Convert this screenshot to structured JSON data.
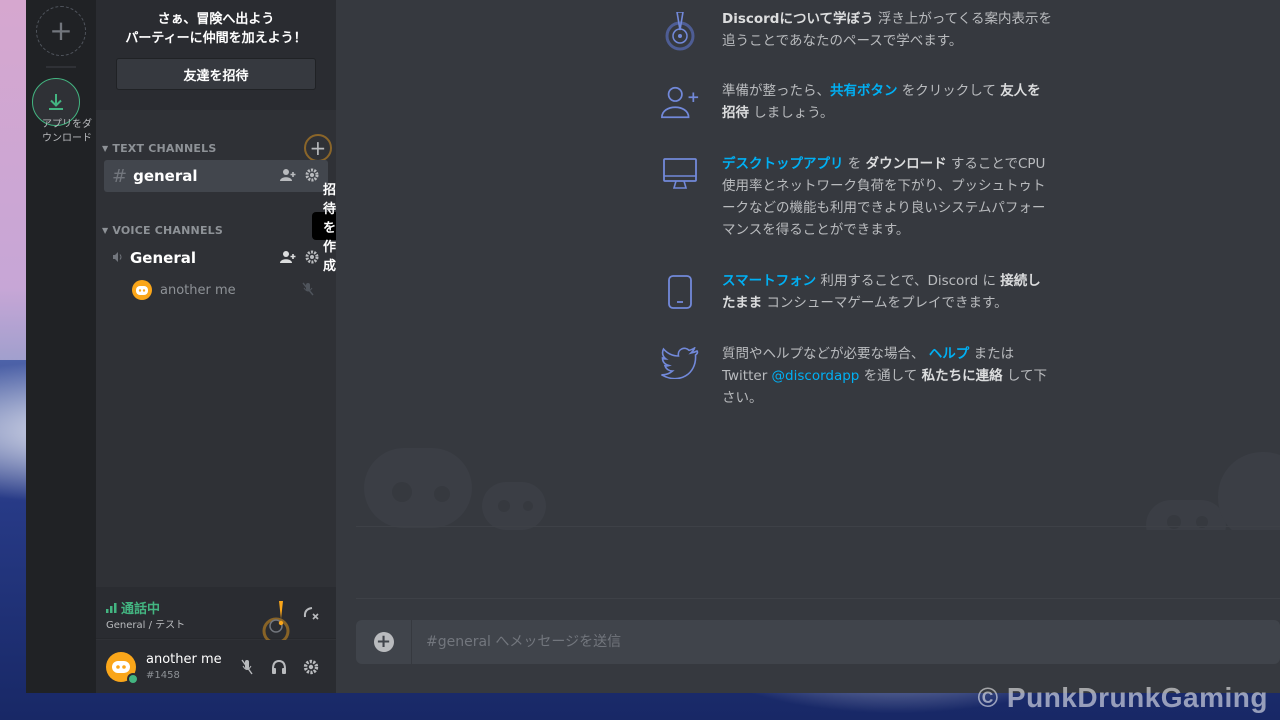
{
  "guild_rail": {
    "add_server": "+",
    "download_label": "アプリをダウンロード"
  },
  "sidebar": {
    "invite": {
      "title_line1": "さぁ、冒険へ出よう",
      "title_line2": "パーティーに仲間を加えよう！",
      "button": "友達を招待"
    },
    "text_category": "TEXT CHANNELS",
    "voice_category": "VOICE CHANNELS",
    "text_channels": [
      {
        "name": "general"
      }
    ],
    "voice_channels": [
      {
        "name": "General"
      }
    ],
    "voice_users": [
      {
        "name": "another me"
      }
    ],
    "tooltip": "招待を作成"
  },
  "voice_panel": {
    "status": "通話中",
    "channel": "General / テスト"
  },
  "user_panel": {
    "username": "another me",
    "tag": "#1458"
  },
  "welcome": {
    "items": [
      {
        "icon": "quest-icon",
        "parts": [
          [
            "b",
            "Discordについて学ぼう"
          ],
          [
            "t",
            " 浮き上がってくる案内表示を追うことであなたのペースで学べます。"
          ]
        ]
      },
      {
        "icon": "add-friend-icon",
        "parts": [
          [
            "t",
            "準備が整ったら、"
          ],
          [
            "l",
            "共有ボタン"
          ],
          [
            "t",
            " をクリックして "
          ],
          [
            "b",
            "友人を招待"
          ],
          [
            "t",
            " しましょう。"
          ]
        ]
      },
      {
        "icon": "desktop-icon",
        "parts": [
          [
            "l",
            "デスクトップアプリ"
          ],
          [
            "t",
            " を "
          ],
          [
            "b",
            "ダウンロード"
          ],
          [
            "t",
            " することでCPU使用率とネットワーク負荷を下がり、プッシュトゥトークなどの機能も利用できより良いシステムパフォーマンスを得ることができます。"
          ]
        ]
      },
      {
        "icon": "smartphone-icon",
        "parts": [
          [
            "l",
            "スマートフォン"
          ],
          [
            "t",
            " 利用することで、Discord に "
          ],
          [
            "b",
            "接続したまま"
          ],
          [
            "t",
            " コンシューマゲームをプレイできます。"
          ]
        ]
      },
      {
        "icon": "twitter-icon",
        "parts": [
          [
            "t",
            "質問やヘルプなどが必要な場合、 "
          ],
          [
            "l",
            "ヘルプ"
          ],
          [
            "t",
            " または Twitter "
          ],
          [
            "ln",
            "@discordapp"
          ],
          [
            "t",
            " を通して "
          ],
          [
            "b",
            "私たちに連絡"
          ],
          [
            "t",
            " して下さい。"
          ]
        ]
      }
    ]
  },
  "composer": {
    "placeholder": "#general へメッセージを送信"
  },
  "watermark": "© PunkDrunkGaming",
  "colors": {
    "accent_green": "#43b581",
    "link_blue": "#00b0f4",
    "alert_orange": "#faa61a",
    "bg_main": "#36393f",
    "bg_sidebar": "#2f3136",
    "bg_rail": "#202225"
  }
}
